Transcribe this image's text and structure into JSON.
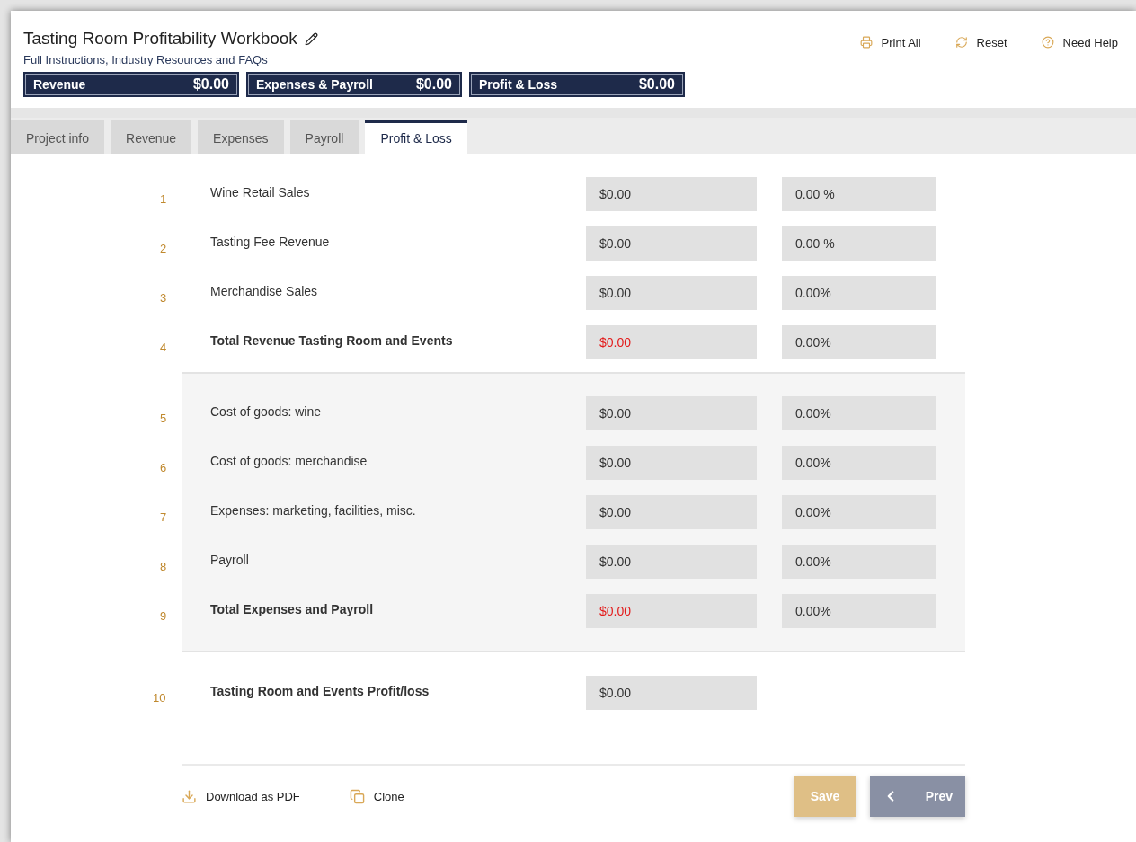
{
  "header": {
    "title": "Tasting Room Profitability Workbook",
    "link": "Full Instructions, Industry Resources and FAQs",
    "actions": [
      {
        "kind": "print",
        "label": "Print All"
      },
      {
        "kind": "reset",
        "label": "Reset"
      },
      {
        "kind": "help",
        "label": "Need Help"
      }
    ],
    "summaries": [
      {
        "label": "Revenue",
        "value": "$0.00"
      },
      {
        "label": "Expenses & Payroll",
        "value": "$0.00"
      },
      {
        "label": "Profit & Loss",
        "value": "$0.00"
      }
    ]
  },
  "tabs": [
    {
      "label": "Project info",
      "selected": false
    },
    {
      "label": "Revenue",
      "selected": false
    },
    {
      "label": "Expenses",
      "selected": false
    },
    {
      "label": "Payroll",
      "selected": false
    },
    {
      "label": "Profit & Loss",
      "selected": true
    }
  ],
  "sections": [
    {
      "shaded": false,
      "rows": [
        {
          "number": "1",
          "label": "Wine Retail Sales",
          "total": false,
          "value": "$0.00",
          "percent": "0.00 %"
        },
        {
          "number": "2",
          "label": "Tasting Fee Revenue",
          "total": false,
          "value": "$0.00",
          "percent": "0.00 %"
        },
        {
          "number": "3",
          "label": "Merchandise Sales",
          "total": false,
          "value": "$0.00",
          "percent": "0.00%"
        },
        {
          "number": "4",
          "label": "Total Revenue Tasting Room and Events",
          "total": true,
          "value": "$0.00",
          "percent": "0.00%"
        }
      ]
    },
    {
      "shaded": true,
      "rows": [
        {
          "number": "5",
          "label": "Cost of goods: wine",
          "total": false,
          "value": "$0.00",
          "percent": "0.00%"
        },
        {
          "number": "6",
          "label": "Cost of goods: merchandise",
          "total": false,
          "value": "$0.00",
          "percent": "0.00%"
        },
        {
          "number": "7",
          "label": "Expenses: marketing, facilities, misc.",
          "total": false,
          "value": "$0.00",
          "percent": "0.00%"
        },
        {
          "number": "8",
          "label": "Payroll",
          "total": false,
          "value": "$0.00",
          "percent": "0.00%"
        },
        {
          "number": "9",
          "label": "Total Expenses and Payroll",
          "total": true,
          "value": "$0.00",
          "percent": "0.00%"
        }
      ]
    },
    {
      "shaded": false,
      "rows": [
        {
          "number": "10",
          "label": "Tasting Room and Events Profit/loss",
          "total": true,
          "value": "$0.00",
          "value_red": false
        }
      ]
    }
  ],
  "footer": {
    "links": [
      {
        "kind": "download",
        "label": "Download as PDF"
      },
      {
        "kind": "clone",
        "label": "Clone"
      }
    ],
    "buttons": [
      {
        "kind": "save",
        "label": "Save"
      },
      {
        "kind": "prev",
        "label": "Prev"
      }
    ]
  }
}
